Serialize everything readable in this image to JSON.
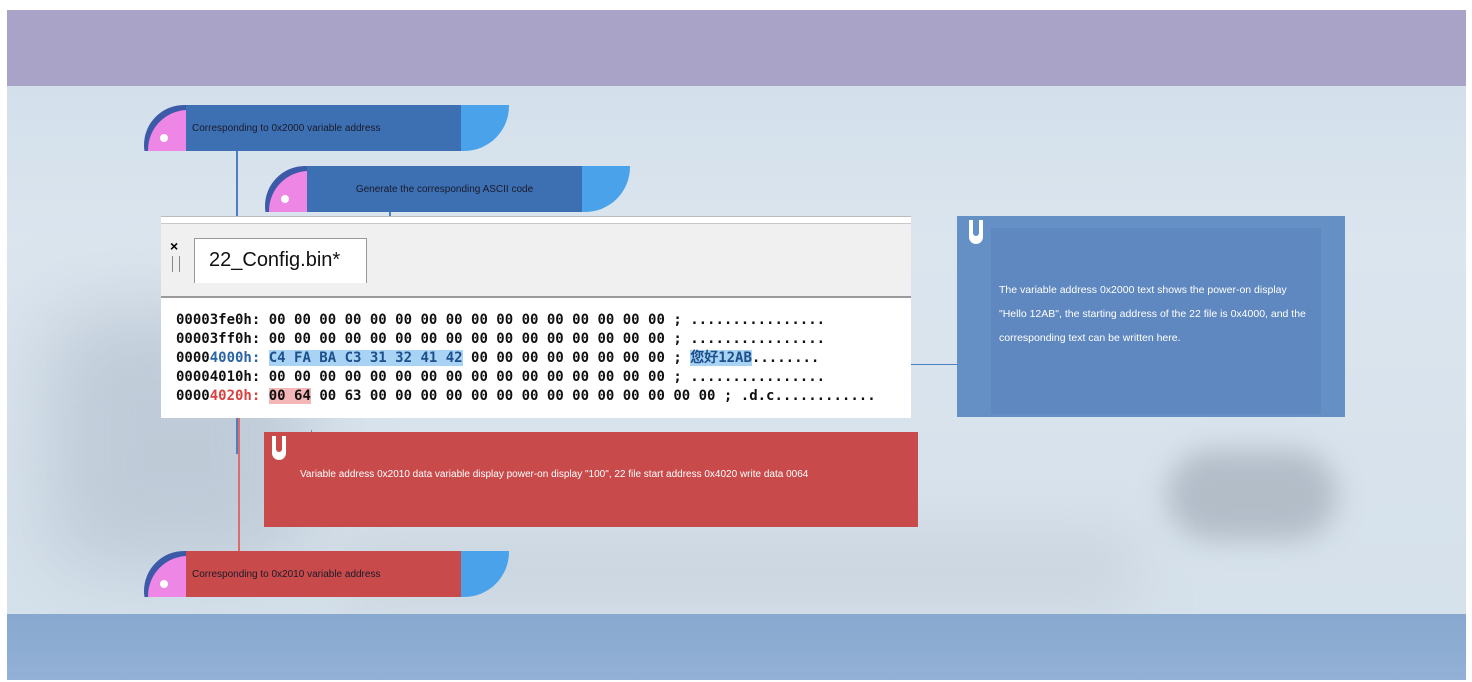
{
  "callouts": {
    "top1": "Corresponding to 0x2000 variable address",
    "top2": "Generate the corresponding ASCII code",
    "bottom": "Corresponding to 0x2010 variable address"
  },
  "hex_editor": {
    "close_glyph": "×",
    "file_tab": "22_Config.bin*",
    "rows": [
      {
        "pre": "00003fe0h:",
        "addr_hl": "",
        "bytes_hl": "",
        "bytes_rest": "00 00 00 00 00 00 00 00 00 00 00 00 00 00 00 00",
        "ascii_hl": "",
        "ascii_rest": "................"
      },
      {
        "pre": "00003ff0h:",
        "addr_hl": "",
        "bytes_hl": "",
        "bytes_rest": "00 00 00 00 00 00 00 00 00 00 00 00 00 00 00 00",
        "ascii_hl": "",
        "ascii_rest": "................"
      },
      {
        "pre": "0000",
        "addr_hl": "4000h:",
        "bytes_hl": "C4 FA BA C3 31 32 41 42",
        "bytes_rest": " 00 00 00 00 00 00 00 00",
        "ascii_hl": "您好12AB",
        "ascii_rest": "........"
      },
      {
        "pre": "00004010h:",
        "addr_hl": "",
        "bytes_hl": "",
        "bytes_rest": "00 00 00 00 00 00 00 00 00 00 00 00 00 00 00 00",
        "ascii_hl": "",
        "ascii_rest": "................"
      },
      {
        "pre": "0000",
        "addr_hl": "4020h:",
        "bytes_hl": "00 64",
        "bytes_rest": " 00 63 00 00 00 00 00 00 00 00 00 00 00 00 00 00",
        "ascii_hl": "",
        "ascii_rest": ".d.c............"
      }
    ],
    "separator": ";"
  },
  "info_blue": {
    "text": "The variable address 0x2000 text shows the power-on display \"Hello 12AB\", the starting address of the 22 file is 0x4000, and the corresponding text can be written here."
  },
  "info_red": {
    "text": "Variable address 0x2010 data variable display power-on display \"100\", 22 file start address 0x4020 write data 0064"
  },
  "colors": {
    "top_band": "#a9a3c8",
    "bottom_band": "#8eacd2",
    "tab_blue": "#3d70b3",
    "tab_red": "#c94a4a",
    "tab_accent": "#4aa3ea",
    "wedge_pink": "#ee86e6",
    "info_blue": "#6590c6",
    "info_red": "#c94a4a",
    "highlight_blue": "#a9d3f5",
    "highlight_red": "#f4b6b6"
  }
}
